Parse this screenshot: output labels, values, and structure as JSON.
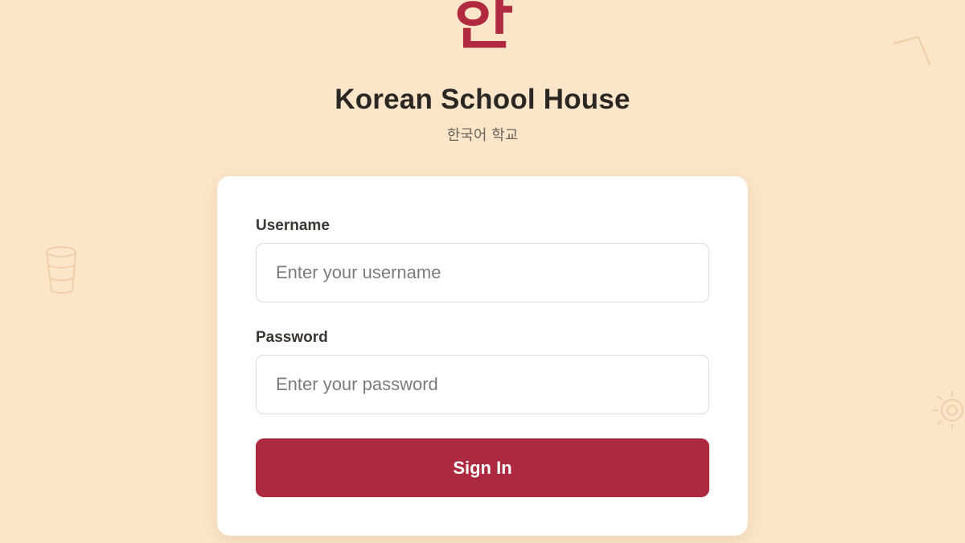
{
  "brand": {
    "logo_char": "한",
    "title": "Korean School House",
    "subtitle": "한국어 학교"
  },
  "login_form": {
    "username_label": "Username",
    "username_placeholder": "Enter your username",
    "username_value": "",
    "password_label": "Password",
    "password_placeholder": "Enter your password",
    "password_value": "",
    "submit_label": "Sign In"
  },
  "decorations": [
    "cup-doodle-icon",
    "corner-doodle-icon",
    "sun-doodle-icon"
  ],
  "colors": {
    "background": "#fce5c8",
    "accent": "#ac2940",
    "logo": "#b12a40",
    "card": "#ffffff"
  }
}
